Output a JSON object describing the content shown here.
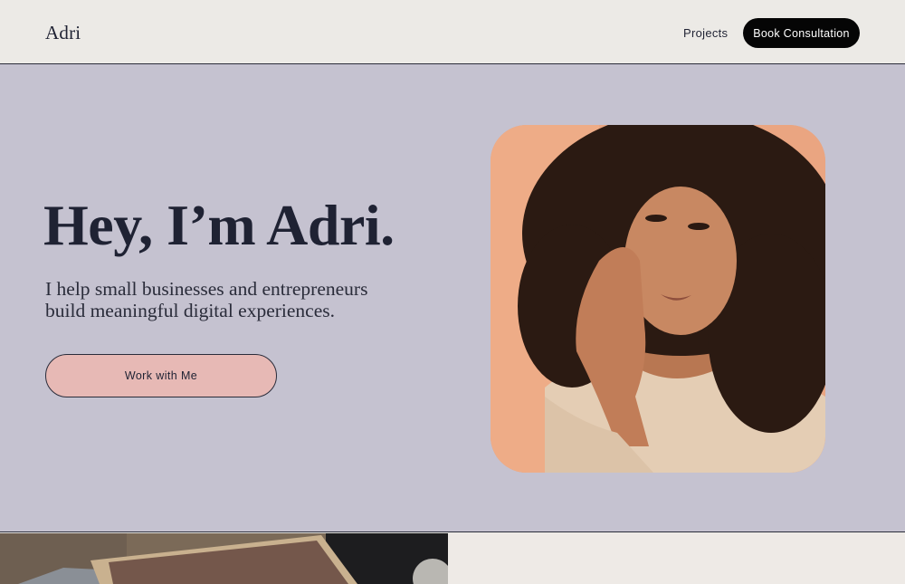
{
  "header": {
    "logo": "Adri",
    "nav_projects": "Projects",
    "cta_label": "Book Consultation"
  },
  "hero": {
    "title": "Hey, I’m Adri.",
    "subtitle": "I help small businesses and entrepreneurs build meaningful digital experiences.",
    "button_label": "Work with Me",
    "portrait_icon": "portrait-photo"
  },
  "colors": {
    "page_bg": "#eceae6",
    "hero_bg": "#c5c2d0",
    "ink": "#1f2233",
    "cta_bg": "#050505",
    "button_bg": "#e7b9b5",
    "portrait_bg": "#e8a27f"
  }
}
